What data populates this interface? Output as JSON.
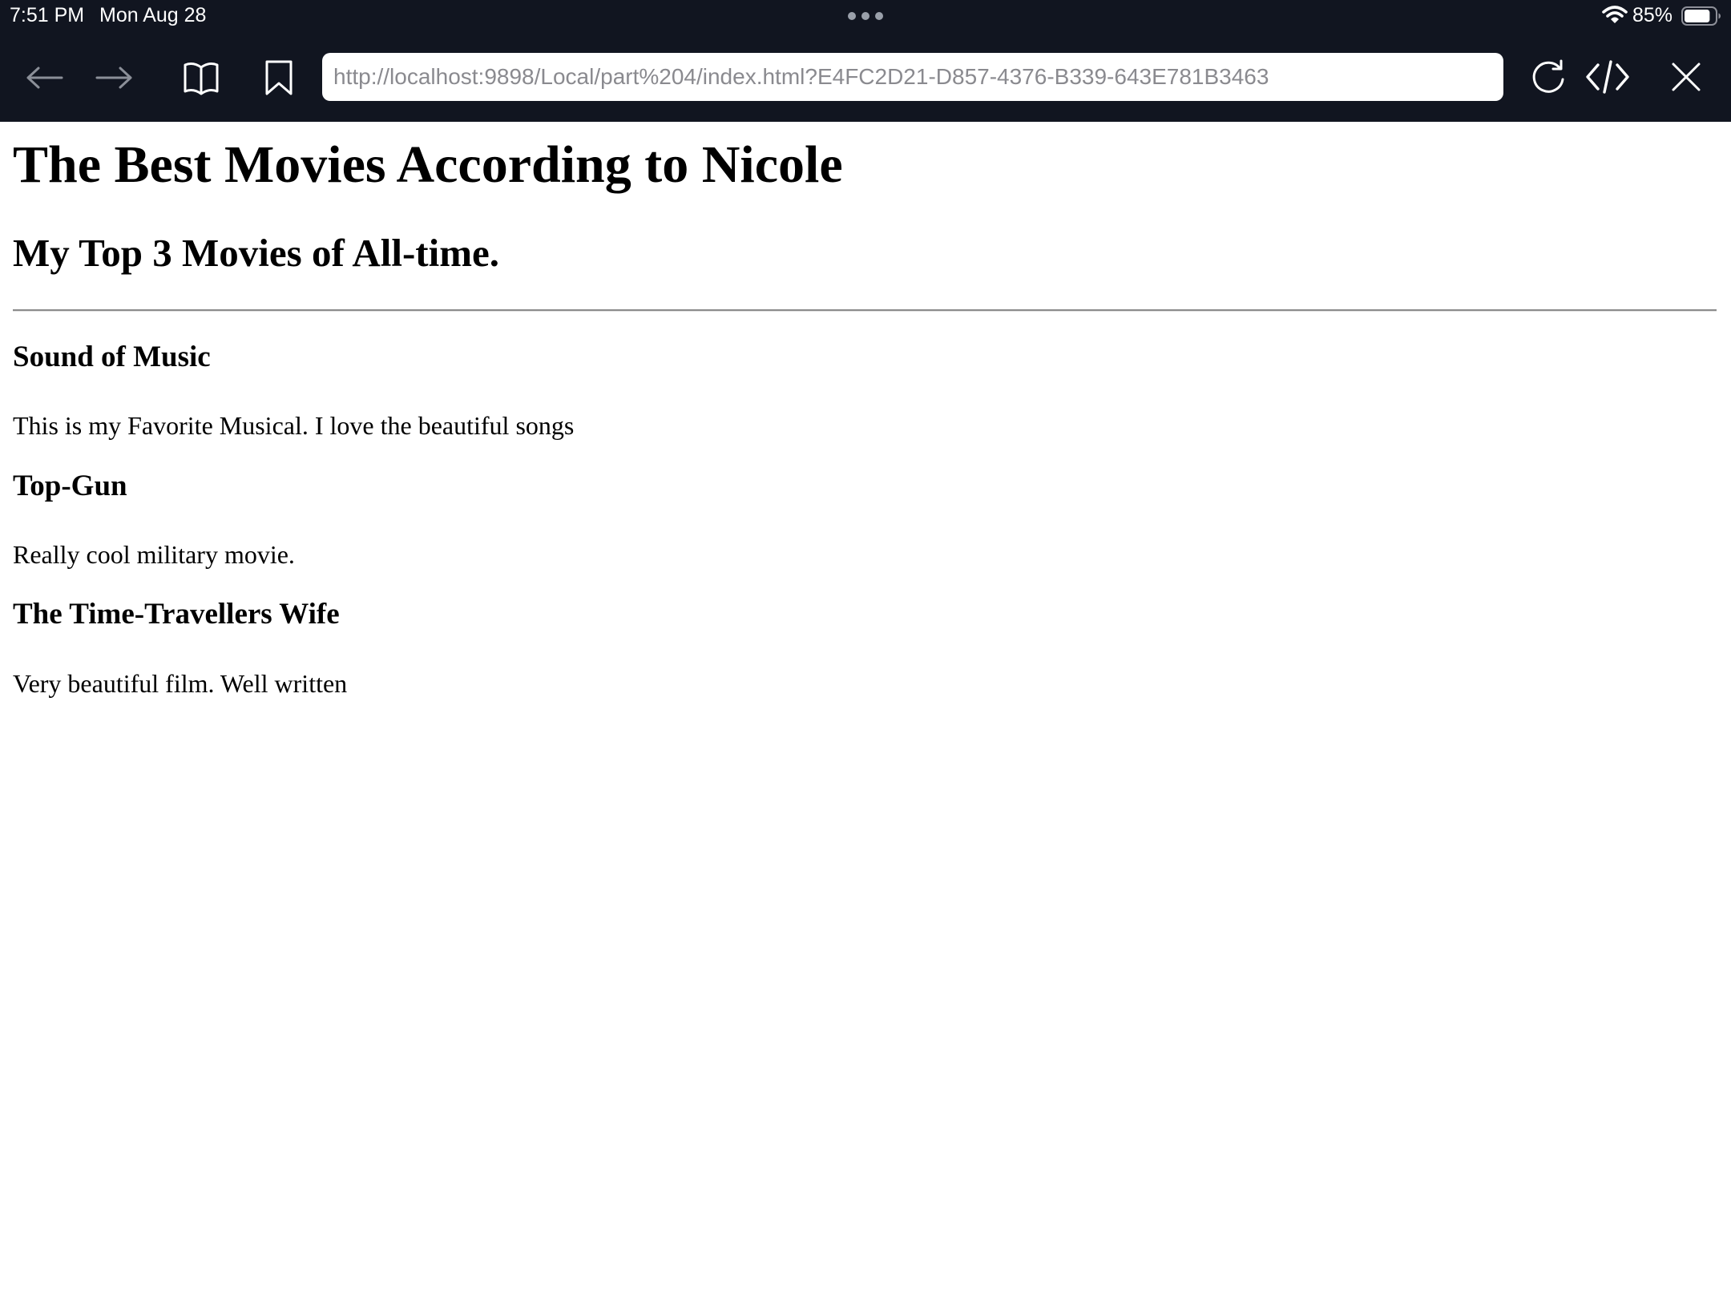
{
  "status_bar": {
    "time": "7:51 PM",
    "date": "Mon Aug 28",
    "battery_percent": "85%",
    "battery_level": 0.85,
    "icons": [
      "multitask-dots-icon",
      "wifi-icon",
      "battery-icon"
    ]
  },
  "toolbar": {
    "url": "http://localhost:9898/Local/part%204/index.html?E4FC2D21-D857-4376-B339-643E781B3463",
    "icons": [
      "back-arrow-icon",
      "forward-arrow-icon",
      "book-icon",
      "bookmark-icon",
      "reload-icon",
      "code-icon",
      "close-icon"
    ]
  },
  "page": {
    "title": "The Best Movies According to Nicole",
    "subtitle": "My Top 3 Movies of All-time.",
    "movies": [
      {
        "title": "Sound of Music",
        "description": "This is my Favorite Musical. I love the beautiful songs"
      },
      {
        "title": "Top-Gun",
        "description": "Really cool military movie."
      },
      {
        "title": "The Time-Travellers Wife",
        "description": "Very beautiful film. Well written"
      }
    ]
  }
}
